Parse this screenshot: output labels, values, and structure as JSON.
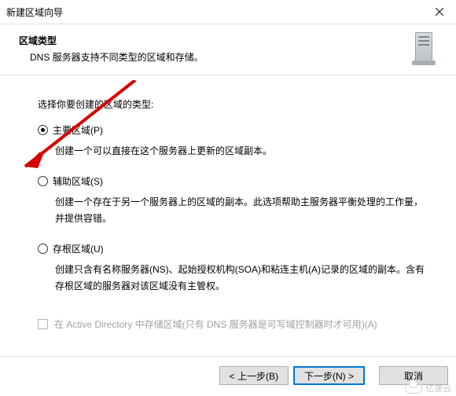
{
  "window": {
    "title": "新建区域向导"
  },
  "header": {
    "title": "区域类型",
    "subtitle": "DNS 服务器支持不同类型的区域和存储。"
  },
  "prompt": "选择你要创建的区域的类型:",
  "options": {
    "primary": {
      "label": "主要区域(P)",
      "desc": "创建一个可以直接在这个服务器上更新的区域副本。",
      "checked": true
    },
    "secondary": {
      "label": "辅助区域(S)",
      "desc": "创建一个存在于另一个服务器上的区域的副本。此选项帮助主服务器平衡处理的工作量，并提供容错。",
      "checked": false
    },
    "stub": {
      "label": "存根区域(U)",
      "desc": "创建只含有名称服务器(NS)、起始授权机构(SOA)和粘连主机(A)记录的区域的副本。含有存根区域的服务器对该区域没有主管权。",
      "checked": false
    }
  },
  "adCheckbox": {
    "label": "在 Active Directory 中存储区域(只有 DNS 服务器是可写域控制器时才可用)(A)",
    "checked": false,
    "enabled": false
  },
  "buttons": {
    "back": "< 上一步(B)",
    "next": "下一步(N) >",
    "cancel": "取消"
  },
  "watermark": "亿速云"
}
